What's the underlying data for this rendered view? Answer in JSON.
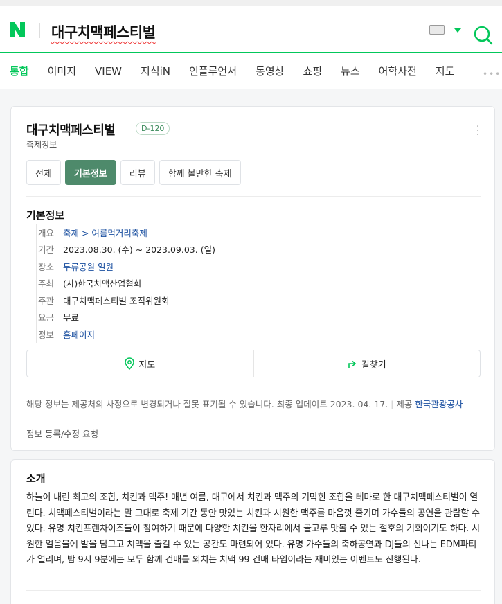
{
  "search": {
    "query": "대구치맥페스티벌"
  },
  "tabs": [
    "통합",
    "이미지",
    "VIEW",
    "지식iN",
    "인플루언서",
    "동영상",
    "쇼핑",
    "뉴스",
    "어학사전",
    "지도"
  ],
  "card": {
    "title": "대구치맥페스티벌",
    "dday": "D-120",
    "subtitle": "축제정보",
    "chips": [
      "전체",
      "기본정보",
      "리뷰",
      "함께 볼만한 축제"
    ],
    "section_title": "기본정보",
    "info": [
      {
        "key": "개요",
        "value": "축제 > 여름먹거리축제",
        "link": true
      },
      {
        "key": "기간",
        "value": "2023.08.30. (수) ~ 2023.09.03. (일)",
        "link": false
      },
      {
        "key": "장소",
        "value": "두류공원 일원",
        "link": true
      },
      {
        "key": "주최",
        "value": "(사)한국치맥산업협회",
        "link": false
      },
      {
        "key": "주관",
        "value": "대구치맥페스티벌 조직위원회",
        "link": false
      },
      {
        "key": "요금",
        "value": "무료",
        "link": false
      },
      {
        "key": "정보",
        "value": "홈페이지",
        "link": true
      }
    ],
    "buttons": {
      "map": "지도",
      "directions": "길찾기"
    },
    "note": "해당 정보는 제공처의 사정으로 변경되거나 잘못 표기될 수 있습니다. 최종 업데이트 2023. 04. 17.",
    "note_provider_label": "제공",
    "note_provider": "한국관광공사",
    "edit_link": "정보 등록/수정 요청"
  },
  "intro": {
    "title": "소개",
    "text": "하늘이 내린 최고의 조합, 치킨과 맥주! 매년 여름, 대구에서 치킨과 맥주의 기막힌 조합을 테마로 한 대구치맥페스티벌이 열린다. 치맥페스티벌이라는 말 그대로 축제 기간 동안 맛있는 치킨과 시원한 맥주를 마음껏 즐기며 가수들의 공연을 관람할 수 있다. 유명 치킨프렌차이즈들이 참여하기 때문에 다양한 치킨을 한자리에서 골고루 맛볼 수 있는 절호의 기회이기도 하다. 시원한 얼음물에 발을 담그고 치맥을 즐길 수 있는 공간도 마련되어 있다. 유명 가수들의 축하공연과 DJ들의 신나는 EDM파티가 열리며, 밤 9시 9분에는 모두 함께 건배를 외치는 치맥 99 건배 타임이라는 재미있는 이벤트도 진행된다."
  },
  "colors": {
    "brand": "#03c75a",
    "chip_active": "#4e8a6b",
    "link": "#1a4fa0"
  }
}
